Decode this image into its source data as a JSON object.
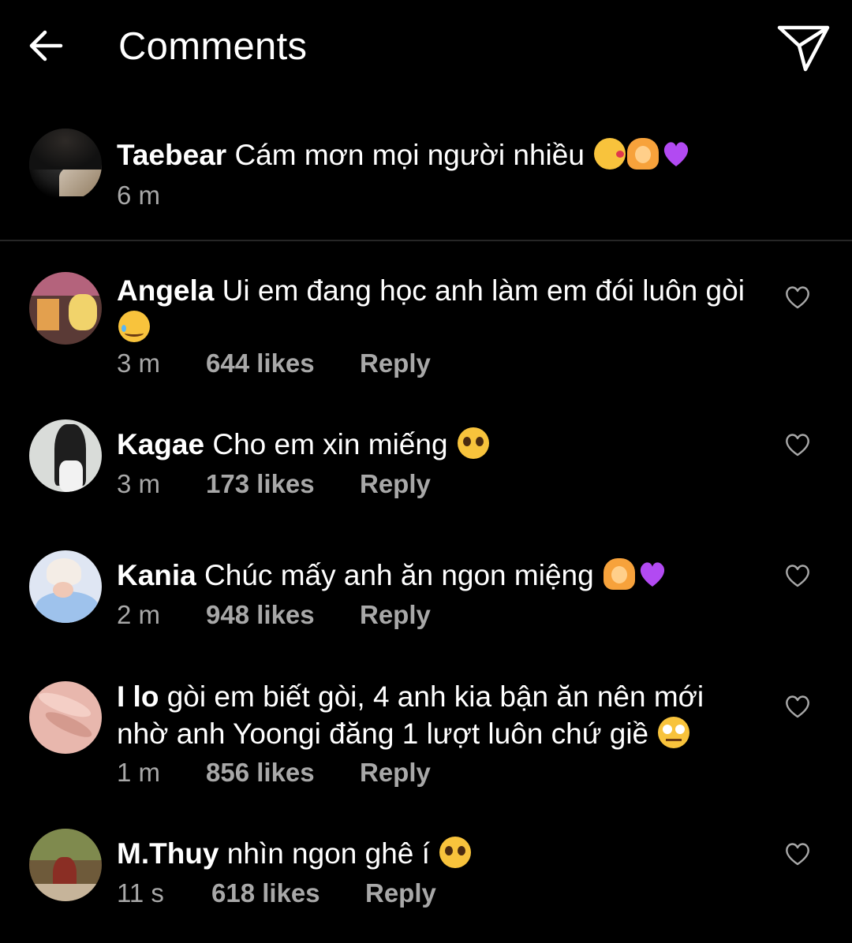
{
  "header": {
    "title": "Comments",
    "back_icon": "arrow-left-icon",
    "share_icon": "paper-plane-icon"
  },
  "caption": {
    "username": "Taebear",
    "text": "Cám mơn mọi người nhiều",
    "emojis": [
      "kissing-heart-emoji",
      "person-gesturing-ok-emoji",
      "purple-heart-emoji"
    ],
    "time": "6 m"
  },
  "comments": [
    {
      "username": "Angela",
      "text": "Ui em đang học anh làm em đói luôn gòi",
      "emojis": [
        "smiling-face-with-tear-emoji"
      ],
      "time": "3 m",
      "likes": "644 likes",
      "reply": "Reply"
    },
    {
      "username": "Kagae",
      "text": "Cho em xin miếng",
      "emojis": [
        "pleading-face-emoji"
      ],
      "time": "3 m",
      "likes": "173 likes",
      "reply": "Reply"
    },
    {
      "username": "Kania",
      "text": "Chúc mấy anh ăn ngon miệng",
      "emojis": [
        "person-gesturing-ok-emoji",
        "purple-heart-emoji"
      ],
      "time": "2 m",
      "likes": "948 likes",
      "reply": "Reply"
    },
    {
      "username": "I lo",
      "text": "gòi em biết gòi, 4 anh kia bận ăn nên mới nhờ anh Yoongi đăng 1 lượt luôn chứ giề",
      "emojis": [
        "face-with-rolling-eyes-emoji"
      ],
      "time": "1 m",
      "likes": "856 likes",
      "reply": "Reply"
    },
    {
      "username": "M.Thuy",
      "text": "nhìn ngon ghê í",
      "emojis": [
        "pleading-face-emoji"
      ],
      "time": "11 s",
      "likes": "618 likes",
      "reply": "Reply"
    }
  ],
  "colors": {
    "background": "#000000",
    "text": "#ffffff",
    "meta": "#a8a8a8",
    "divider": "#262626"
  }
}
